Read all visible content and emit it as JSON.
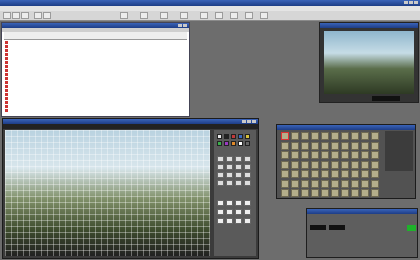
{
  "app": {
    "title": ""
  },
  "menu": [
    "",
    "",
    "",
    "",
    "",
    "",
    "",
    "",
    ""
  ],
  "clip_list": {
    "title": "",
    "rows": [
      {
        "name": "",
        "c1": "",
        "c2": ""
      },
      {
        "name": "",
        "c1": "",
        "c2": ""
      },
      {
        "name": "",
        "c1": "",
        "c2": ""
      },
      {
        "name": "",
        "c1": "",
        "c2": ""
      },
      {
        "name": "",
        "c1": "",
        "c2": ""
      },
      {
        "name": "",
        "c1": "",
        "c2": ""
      },
      {
        "name": "",
        "c1": "",
        "c2": ""
      },
      {
        "name": "",
        "c1": "",
        "c2": ""
      },
      {
        "name": "",
        "c1": "",
        "c2": ""
      },
      {
        "name": "",
        "c1": "",
        "c2": ""
      },
      {
        "name": "",
        "c1": "",
        "c2": ""
      },
      {
        "name": "",
        "c1": "",
        "c2": ""
      },
      {
        "name": "",
        "c1": "",
        "c2": ""
      },
      {
        "name": "",
        "c1": "",
        "c2": ""
      },
      {
        "name": "",
        "c1": "",
        "c2": ""
      },
      {
        "name": "",
        "c1": "",
        "c2": ""
      },
      {
        "name": "",
        "c1": "",
        "c2": ""
      },
      {
        "name": "",
        "c1": "",
        "c2": ""
      }
    ]
  },
  "preview": {
    "title": "",
    "timecode": ""
  },
  "editor": {
    "title": "",
    "subtitle": ""
  },
  "char_panel": {
    "title": ""
  },
  "timeline": {
    "title": "",
    "tc1": "",
    "tc2": ""
  },
  "colors": {
    "accent": "#1db32a",
    "titlebar": "#2a4ea0"
  }
}
